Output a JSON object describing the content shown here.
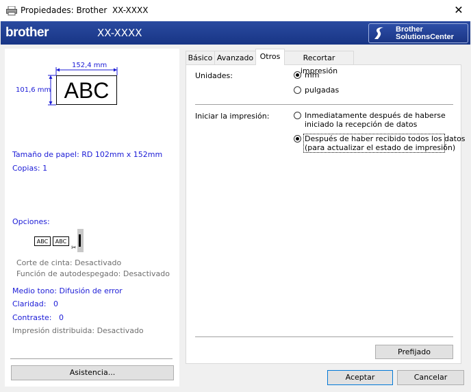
{
  "window": {
    "title": "Propiedades: Brother  XX-XXXX",
    "close_glyph": "✕"
  },
  "header": {
    "brand": "brother",
    "model": "XX-XXXX",
    "solutions_center": {
      "line1": "Brother",
      "line2": "SolutionsCenter"
    },
    "brand_color": "#1c3a8c"
  },
  "preview": {
    "width_label": "152,4 mm",
    "height_label": "101,6 mm",
    "sample_text": "ABC",
    "paper_size": "Tamaño de papel: RD 102mm x 152mm",
    "copies": "Copias: 1",
    "options_label": "Opciones:",
    "options_icon": {
      "abc1": "ABC",
      "abc2": "ABC"
    },
    "cut": "Corte de cinta: Desactivado",
    "peel": "Función de autodespegado: Desactivado",
    "halftone": "Medio tono: Difusión de error",
    "brightness": "Claridad:   0",
    "contrast": "Contraste:   0",
    "distributed": "Impresión distribuida: Desactivado",
    "help_button": "Asistencia..."
  },
  "tabs": [
    {
      "label": "Básico",
      "active": false
    },
    {
      "label": "Avanzado",
      "active": false
    },
    {
      "label": "Otros",
      "active": true
    },
    {
      "label": "Recortar impresión",
      "active": false
    }
  ],
  "units": {
    "label": "Unidades:",
    "options": [
      {
        "label": "mm",
        "selected": true
      },
      {
        "label": "pulgadas",
        "selected": false
      }
    ]
  },
  "start_print": {
    "label": "Iniciar la impresión:",
    "options": [
      {
        "line1": "Inmediatamente después de haberse",
        "line2": "iniciado la recepción de datos",
        "selected": false
      },
      {
        "line1": "Después de haber recibido todos los datos",
        "line2": "(para actualizar el estado de impresión)",
        "selected": true
      }
    ]
  },
  "buttons": {
    "default": "Prefijado",
    "ok": "Aceptar",
    "cancel": "Cancelar"
  },
  "colors": {
    "link_blue": "#1a1ad6",
    "disabled_gray": "#6e6e6e",
    "focus_blue": "#0078d7"
  }
}
